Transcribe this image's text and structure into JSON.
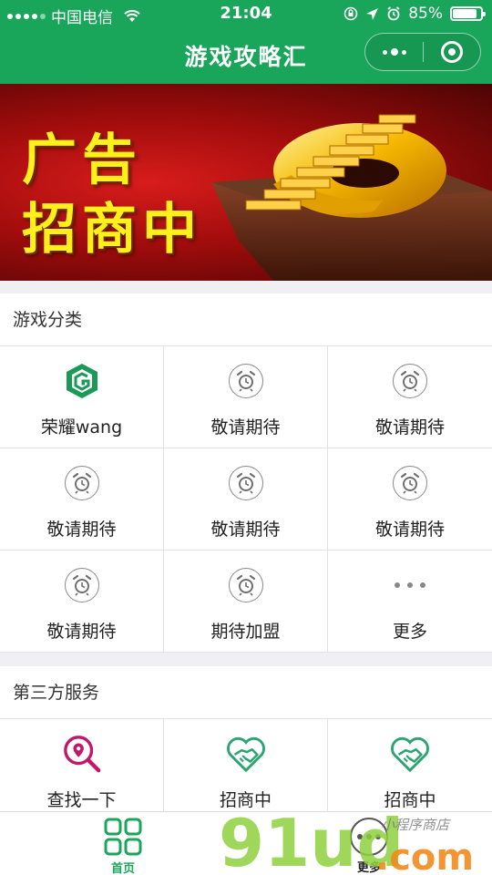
{
  "status_bar": {
    "carrier": "中国电信",
    "time": "21:04",
    "battery_percent_label": "85%",
    "battery_level": 0.85
  },
  "navbar": {
    "title": "游戏攻略汇"
  },
  "banner": {
    "line1": "广告",
    "line2": "招商中"
  },
  "game_categories": {
    "title": "游戏分类",
    "items": [
      {
        "label": "荣耀wang",
        "icon": "honor-logo-icon"
      },
      {
        "label": "敬请期待",
        "icon": "alarm-clock-icon"
      },
      {
        "label": "敬请期待",
        "icon": "alarm-clock-icon"
      },
      {
        "label": "敬请期待",
        "icon": "alarm-clock-icon"
      },
      {
        "label": "敬请期待",
        "icon": "alarm-clock-icon"
      },
      {
        "label": "敬请期待",
        "icon": "alarm-clock-icon"
      },
      {
        "label": "敬请期待",
        "icon": "alarm-clock-icon"
      },
      {
        "label": "期待加盟",
        "icon": "alarm-clock-icon"
      },
      {
        "label": "更多",
        "icon": "more-dots-icon"
      }
    ]
  },
  "third_party": {
    "title": "第三方服务",
    "items": [
      {
        "label": "查找一下",
        "icon": "search-location-icon"
      },
      {
        "label": "招商中",
        "icon": "handshake-heart-icon"
      },
      {
        "label": "招商中",
        "icon": "handshake-heart-icon"
      }
    ]
  },
  "tabbar": {
    "home_label": "首页",
    "more_label": "更多"
  },
  "watermark": {
    "brand": "91ud.com",
    "tagline": "小程序商店"
  },
  "colors": {
    "brand_green": "#19a55a",
    "banner_red": "#c01414",
    "banner_yellow": "#ffef1a",
    "search_magenta": "#c2186b"
  }
}
